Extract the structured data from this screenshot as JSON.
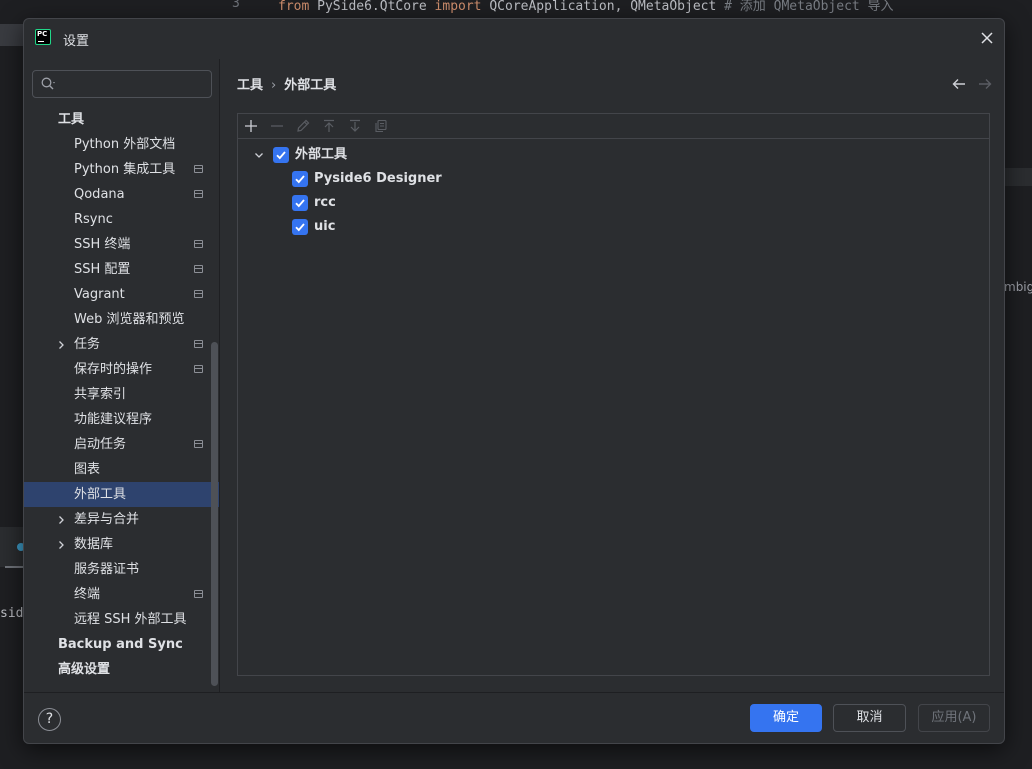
{
  "background": {
    "line_number": "3",
    "code_from": "from",
    "code_module": " PySide6.QtCore ",
    "code_import": "import",
    "code_names": " QCoreApplication, QMetaObject  ",
    "code_comment": "# 添加 QMetaObject 导入",
    "right_fragment": "mbig",
    "left_fragment": "sid"
  },
  "dialog": {
    "title": "设置",
    "app_icon_text": "PC"
  },
  "search": {
    "value": "",
    "placeholder": ""
  },
  "tree": [
    {
      "label": "工具",
      "level": 0,
      "chevron": false,
      "project": false,
      "selected": false
    },
    {
      "label": "Python 外部文档",
      "level": 1,
      "chevron": false,
      "project": false,
      "selected": false
    },
    {
      "label": "Python 集成工具",
      "level": 1,
      "chevron": false,
      "project": true,
      "selected": false
    },
    {
      "label": "Qodana",
      "level": 1,
      "chevron": false,
      "project": true,
      "selected": false
    },
    {
      "label": "Rsync",
      "level": 1,
      "chevron": false,
      "project": false,
      "selected": false
    },
    {
      "label": "SSH 终端",
      "level": 1,
      "chevron": false,
      "project": true,
      "selected": false
    },
    {
      "label": "SSH 配置",
      "level": 1,
      "chevron": false,
      "project": true,
      "selected": false
    },
    {
      "label": "Vagrant",
      "level": 1,
      "chevron": false,
      "project": true,
      "selected": false
    },
    {
      "label": "Web 浏览器和预览",
      "level": 1,
      "chevron": false,
      "project": false,
      "selected": false
    },
    {
      "label": "任务",
      "level": 1,
      "chevron": true,
      "project": true,
      "selected": false
    },
    {
      "label": "保存时的操作",
      "level": 1,
      "chevron": false,
      "project": true,
      "selected": false
    },
    {
      "label": "共享索引",
      "level": 1,
      "chevron": false,
      "project": false,
      "selected": false
    },
    {
      "label": "功能建议程序",
      "level": 1,
      "chevron": false,
      "project": false,
      "selected": false
    },
    {
      "label": "启动任务",
      "level": 1,
      "chevron": false,
      "project": true,
      "selected": false
    },
    {
      "label": "图表",
      "level": 1,
      "chevron": false,
      "project": false,
      "selected": false
    },
    {
      "label": "外部工具",
      "level": 1,
      "chevron": false,
      "project": false,
      "selected": true
    },
    {
      "label": "差异与合并",
      "level": 1,
      "chevron": true,
      "project": false,
      "selected": false
    },
    {
      "label": "数据库",
      "level": 1,
      "chevron": true,
      "project": false,
      "selected": false
    },
    {
      "label": "服务器证书",
      "level": 1,
      "chevron": false,
      "project": false,
      "selected": false
    },
    {
      "label": "终端",
      "level": 1,
      "chevron": false,
      "project": true,
      "selected": false
    },
    {
      "label": "远程 SSH 外部工具",
      "level": 1,
      "chevron": false,
      "project": false,
      "selected": false
    },
    {
      "label": "Backup and Sync",
      "level": 0,
      "chevron": false,
      "project": false,
      "selected": false
    },
    {
      "label": "高级设置",
      "level": 0,
      "chevron": false,
      "project": false,
      "selected": false
    }
  ],
  "breadcrumb": {
    "parent": "工具",
    "separator": "›",
    "current": "外部工具"
  },
  "toolbar": [
    "add-icon",
    "remove-icon",
    "edit-icon",
    "move-up-icon",
    "move-down-icon",
    "copy-icon"
  ],
  "external_tools": {
    "group": {
      "label": "外部工具",
      "checked": true,
      "expanded": true
    },
    "items": [
      {
        "label": "Pyside6 Designer",
        "checked": true
      },
      {
        "label": "rcc",
        "checked": true
      },
      {
        "label": "uic",
        "checked": true
      }
    ]
  },
  "footer": {
    "help_label": "?",
    "ok_label": "确定",
    "cancel_label": "取消",
    "apply_label": "应用(A)"
  },
  "colors": {
    "accent": "#3574f0",
    "selection": "#2e436e",
    "panel": "#2b2d30",
    "text": "#dfe1e5"
  }
}
